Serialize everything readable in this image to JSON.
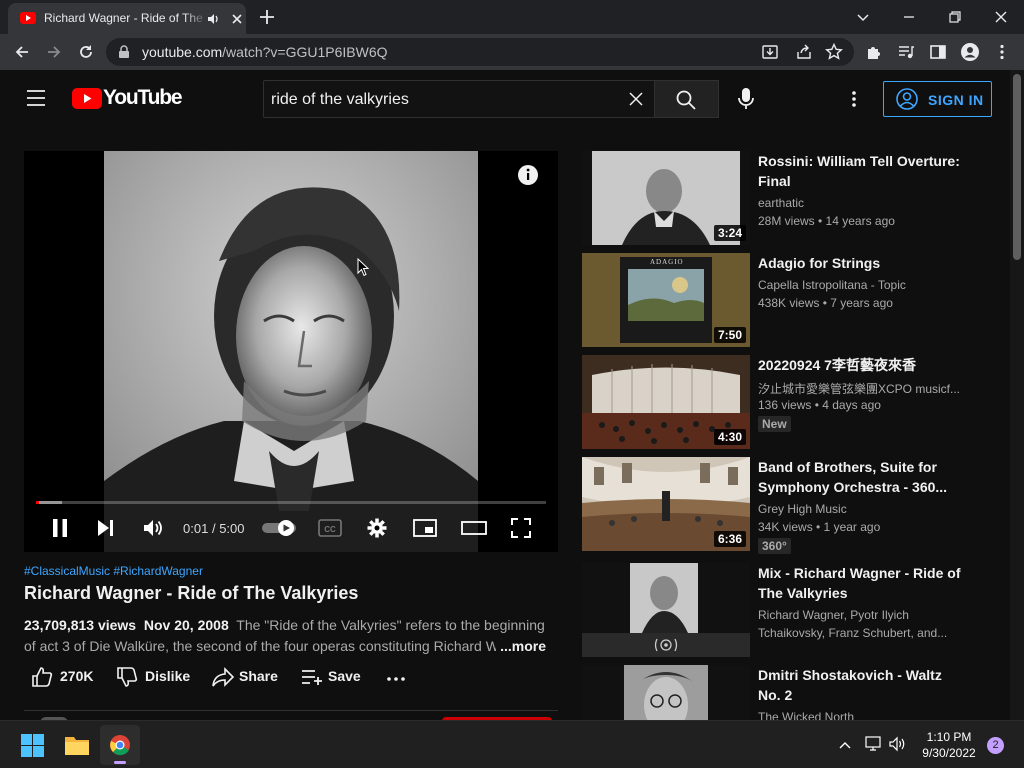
{
  "browser": {
    "tab_title": "Richard Wagner - Ride of The Valkyries",
    "url_host": "youtube.com",
    "url_path": "/watch?v=GGU1P6IBW6Q"
  },
  "youtube": {
    "logo_text": "YouTube",
    "search_query": "ride of the valkyries",
    "signin_label": "SIGN IN"
  },
  "player": {
    "time_current": "0:01",
    "time_separator": "/",
    "time_total": "5:00",
    "played_fraction": 0.003,
    "loaded_fraction": 0.05
  },
  "video": {
    "tags": "#ClassicalMusic #RichardWagner",
    "title": "Richard Wagner - Ride of The Valkyries",
    "views": "23,709,813 views",
    "date": "Nov 20, 2008",
    "description": "The \"Ride of the Valkyries\" refers to the beginning of act 3 of Die Walküre, the second of the four operas constituting Richard Wagner's",
    "more_label": "...more",
    "likes": "270K",
    "dislike_label": "Dislike",
    "share_label": "Share",
    "save_label": "Save"
  },
  "recommendations": [
    {
      "title": "Rossini: William Tell Overture: Final",
      "channel": "earthatic",
      "meta": "28M views • 14 years ago",
      "duration": "3:24"
    },
    {
      "title": "Adagio for Strings",
      "channel": "Capella Istropolitana - Topic",
      "meta": "438K views • 7 years ago",
      "duration": "7:50",
      "thumb_caption": "ADAGIO"
    },
    {
      "title": "20220924 7李哲藝夜來香",
      "channel": "汐止城市愛樂管弦樂團XCPO musicf...",
      "meta": "136 views • 4 days ago",
      "duration": "4:30",
      "badge": "New"
    },
    {
      "title": "Band of Brothers, Suite for Symphony Orchestra - 360...",
      "channel": "Grey High Music",
      "meta": "34K views • 1 year ago",
      "duration": "6:36",
      "badge": "360°"
    },
    {
      "title": "Mix - Richard Wagner - Ride of The Valkyries",
      "channel": "Richard Wagner, Pyotr Ilyich",
      "meta": "Tchaikovsky, Franz Schubert, and..."
    },
    {
      "title": "Dmitri Shostakovich - Waltz No. 2",
      "channel": "The Wicked North"
    }
  ],
  "taskbar": {
    "time": "1:10 PM",
    "date": "9/30/2022",
    "notifications": "2"
  },
  "colors": {
    "youtube_red": "#ff0000",
    "link_blue": "#3ea6ff",
    "page_bg": "#0f0f0f"
  },
  "icons": [
    "youtube-favicon",
    "speaker-icon",
    "close-icon",
    "plus-icon",
    "chevron-down-icon",
    "minimize-icon",
    "restore-icon",
    "back-icon",
    "forward-icon",
    "reload-icon",
    "lock-icon",
    "install-icon",
    "share-icon",
    "star-icon",
    "extensions-icon",
    "media-icon",
    "sidepanel-icon",
    "profile-icon",
    "menu-icon",
    "hamburger-icon",
    "search-icon",
    "mic-icon",
    "kebab-icon",
    "account-icon",
    "info-icon",
    "pause-icon",
    "next-icon",
    "volume-icon",
    "autoplay-toggle",
    "cc-icon",
    "settings-icon",
    "miniplayer-icon",
    "theater-icon",
    "fullscreen-icon",
    "like-icon",
    "dislike-icon",
    "save-icon",
    "more-icon",
    "windows-icon",
    "explorer-icon",
    "chrome-icon",
    "tray-chevron-icon",
    "network-icon",
    "volume-tray-icon"
  ]
}
